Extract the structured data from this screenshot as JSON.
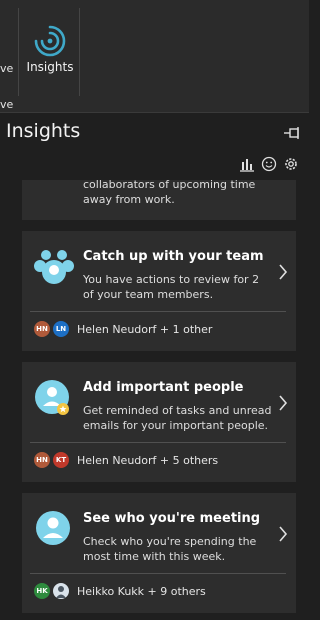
{
  "ribbon": {
    "edge_top": "ve",
    "edge_bottom": "ve",
    "insights_label": "Insights"
  },
  "pane": {
    "title": "Insights"
  },
  "cards": [
    {
      "desc_partial": "collaborators of upcoming time away from work."
    },
    {
      "title": "Catch up with your team",
      "desc": "You have actions to review for 2 of your team members.",
      "avatars": [
        "HN",
        "LN"
      ],
      "footer": "Helen Neudorf + 1 other"
    },
    {
      "title": "Add important people",
      "desc": "Get reminded of tasks and unread emails for your important people.",
      "avatars": [
        "HN",
        "KT"
      ],
      "footer": "Helen Neudorf + 5 others"
    },
    {
      "title": "See who you're meeting",
      "desc": "Check who you're spending the most time with this week.",
      "avatars": [
        "HK"
      ],
      "footer": "Heikko Kukk + 9 others"
    }
  ],
  "colors": {
    "accent": "#3fa9c9",
    "avatar_hn": "#b05a3a",
    "avatar_ln": "#1d6fc4",
    "avatar_kt": "#c0392b",
    "avatar_hk": "#2e8b3e"
  },
  "icons": [
    "insights-icon",
    "pin-icon",
    "chart-icon",
    "smiley-icon",
    "gear-icon",
    "chevron-right-icon",
    "team-icon",
    "person-star-icon",
    "person-icon"
  ]
}
